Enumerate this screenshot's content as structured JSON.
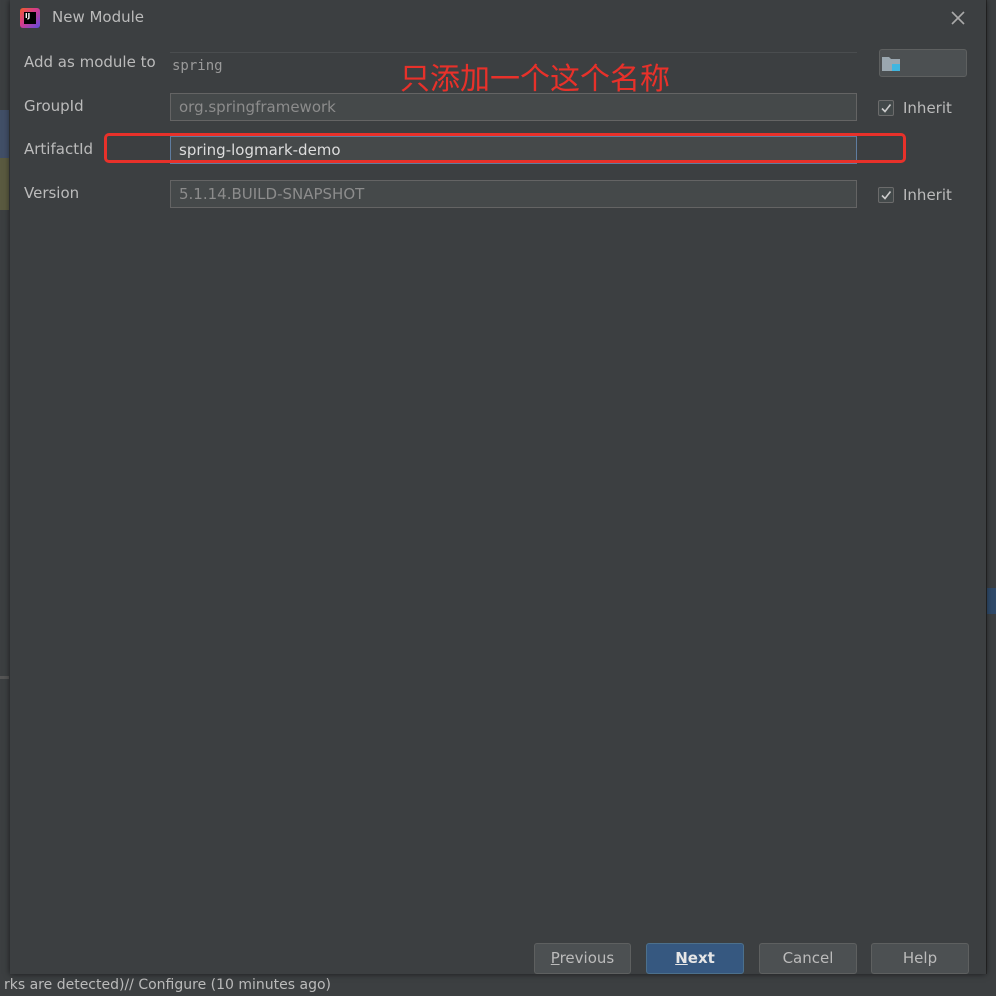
{
  "window": {
    "title": "New Module"
  },
  "form": {
    "add_as_module_to": {
      "label": "Add as module to",
      "value": "spring"
    },
    "group_id": {
      "label": "GroupId",
      "value": "org.springframework",
      "inherit_label": "Inherit",
      "inherit_checked": true
    },
    "artifact_id": {
      "label": "ArtifactId",
      "value": "spring-logmark-demo"
    },
    "version": {
      "label": "Version",
      "value": "5.1.14.BUILD-SNAPSHOT",
      "inherit_label": "Inherit",
      "inherit_checked": true
    }
  },
  "annotation": {
    "text": "只添加一个这个名称",
    "color": "#e8312a"
  },
  "buttons": {
    "previous": {
      "mnemonic": "P",
      "rest": "revious"
    },
    "next": {
      "mnemonic": "N",
      "rest": "ext"
    },
    "cancel": "Cancel",
    "help": "Help"
  },
  "background": {
    "bottom_status": "rks are detected)// Configure (10 minutes ago)"
  },
  "icons": {
    "app": "intellij-idea-icon",
    "close": "close-icon",
    "browse": "folder-icon",
    "check": "checkmark-icon"
  },
  "colors": {
    "dialog_bg": "#3c3f41",
    "primary_button": "#365880",
    "annotation_red": "#e8312a"
  }
}
